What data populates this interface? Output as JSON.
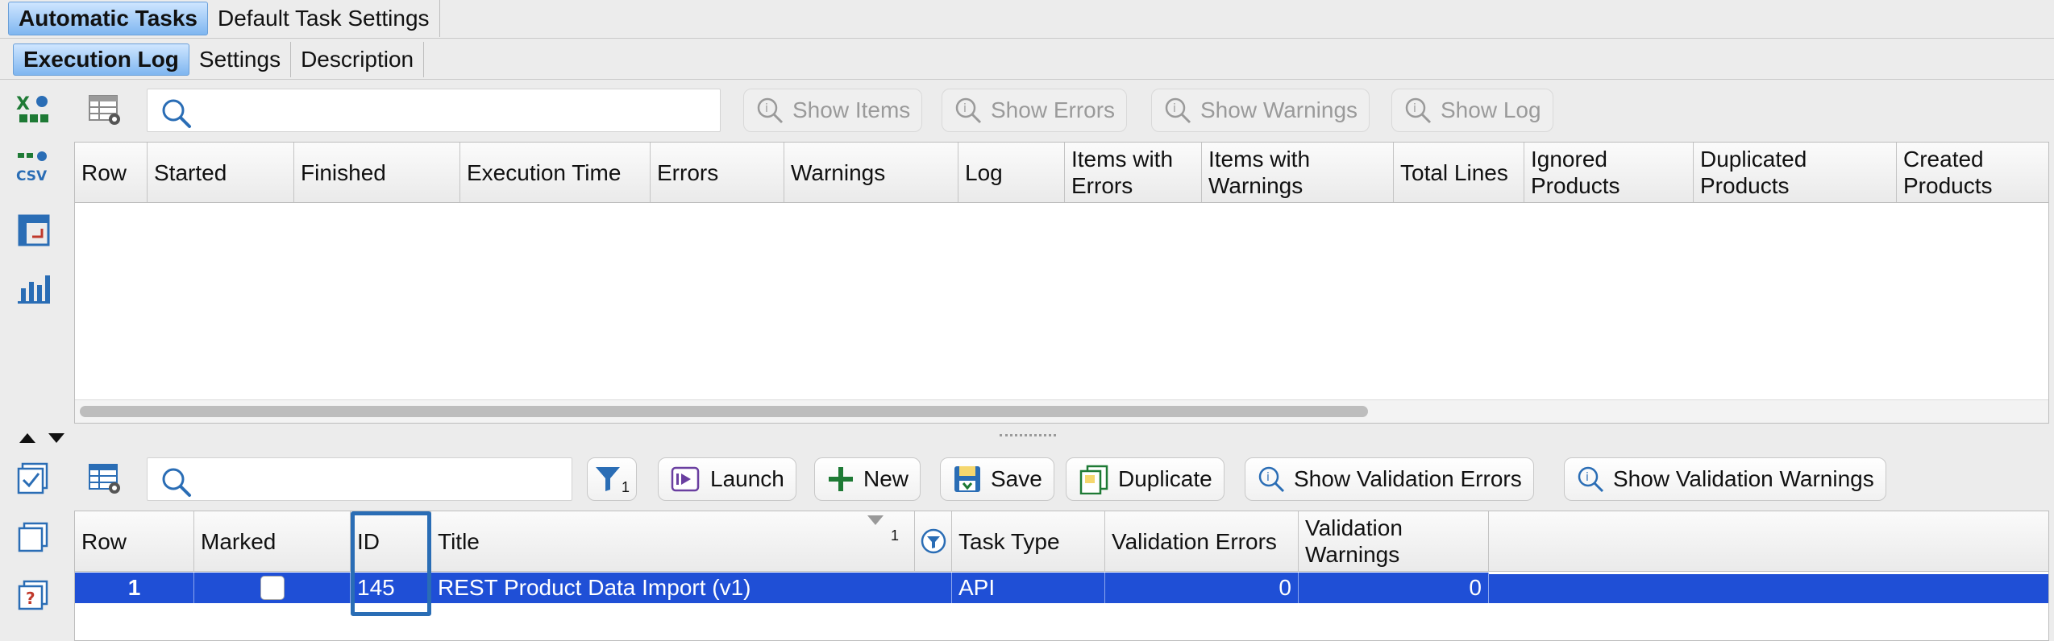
{
  "top_tabs": [
    "Automatic Tasks",
    "Default Task Settings"
  ],
  "sub_tabs": [
    "Execution Log",
    "Settings",
    "Description"
  ],
  "log_toolbar": {
    "search_value": "",
    "buttons": [
      "Show Items",
      "Show Errors",
      "Show Warnings",
      "Show Log"
    ]
  },
  "log_table": {
    "columns": [
      "Row",
      "Started",
      "Finished",
      "Execution Time",
      "Errors",
      "Warnings",
      "Log",
      "Items with Errors",
      "Items with Warnings",
      "Total Lines",
      "Ignored Products",
      "Duplicated Products",
      "Created Products"
    ],
    "rows": []
  },
  "tasks_toolbar": {
    "search_value": "",
    "filter_count": "1",
    "buttons": [
      "Launch",
      "New",
      "Save",
      "Duplicate",
      "Show Validation Errors",
      "Show Validation Warnings"
    ]
  },
  "tasks_table": {
    "columns": [
      "Row",
      "Marked",
      "ID",
      "Title",
      "Task Type",
      "Validation Errors",
      "Validation Warnings"
    ],
    "sort_indicator": "1",
    "rows": [
      {
        "row": "1",
        "marked": false,
        "id": "145",
        "title": "REST Product Data Import (v1)",
        "task_type": "API",
        "validation_errors": "0",
        "validation_warnings": "0"
      }
    ]
  },
  "colors": {
    "selection": "#1f4fd6",
    "focus_border": "#2a6db5",
    "accent_tab": "#7fb6f0"
  }
}
